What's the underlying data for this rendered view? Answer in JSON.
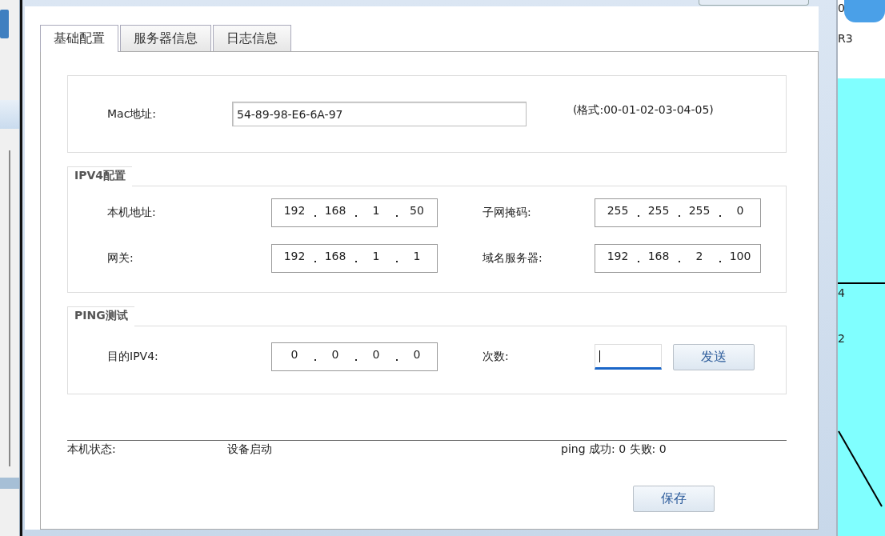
{
  "tabs": [
    {
      "label": "基础配置",
      "selected": true
    },
    {
      "label": "服务器信息",
      "selected": false
    },
    {
      "label": "日志信息",
      "selected": false
    }
  ],
  "mac": {
    "label": "Mac地址:",
    "value": "54-89-98-E6-6A-97",
    "hint": "(格式:00-01-02-03-04-05)"
  },
  "ipv4": {
    "title": "IPV4配置",
    "fields": [
      {
        "label": "本机地址:",
        "octets": [
          "192",
          "168",
          "1",
          "50"
        ]
      },
      {
        "label": "子网掩码:",
        "octets": [
          "255",
          "255",
          "255",
          "0"
        ]
      },
      {
        "label": "网关:",
        "octets": [
          "192",
          "168",
          "1",
          "1"
        ]
      },
      {
        "label": "域名服务器:",
        "octets": [
          "192",
          "168",
          "2",
          "100"
        ]
      }
    ]
  },
  "ping": {
    "title": "PING测试",
    "target": {
      "label": "目的IPV4:",
      "octets": [
        "0",
        "0",
        "0",
        "0"
      ]
    },
    "count": {
      "label": "次数:",
      "focused": true
    },
    "send": "发送"
  },
  "status": {
    "label": "本机状态:",
    "value": "设备启动",
    "result": "ping 成功: 0 失败: 0"
  },
  "save": "保存",
  "background": {
    "labels": [
      "0",
      "R3",
      "4",
      "2"
    ]
  }
}
